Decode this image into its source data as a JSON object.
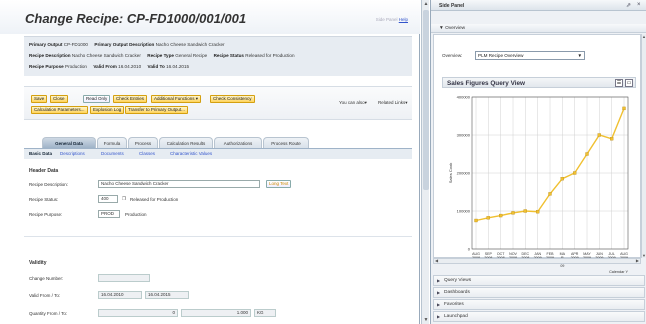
{
  "page": {
    "title": "Change Recipe: CP-FD1000/001/001",
    "side_panel_link_prefix": "Side Panel",
    "side_panel_link": "Help"
  },
  "info": {
    "primary_output_label": "Primary Output",
    "primary_output": "CP-FD1000",
    "primary_output_desc_label": "Primary Output Description",
    "primary_output_desc": "Nacho Cheese Sandwich Cracker",
    "recipe_desc_label": "Recipe Description",
    "recipe_desc": "Nacho Cheese Sandwich Cracker",
    "recipe_type_label": "Recipe Type",
    "recipe_type": "General Recipe",
    "recipe_status_label": "Recipe Status",
    "recipe_status": "Released for Production",
    "recipe_purpose_label": "Recipe Purpose",
    "recipe_purpose": "Production",
    "valid_from_label": "Valid From",
    "valid_from": "16.04.2010",
    "valid_to_label": "Valid To",
    "valid_to": "16.04.2015"
  },
  "toolbar": {
    "save": "Save",
    "close": "Close",
    "read_only": "Read Only",
    "check_entries": "Check Entries",
    "additional_functions": "Additional Functions",
    "check_consistency": "Check Consistency",
    "calc_params": "Calculation Parameters...",
    "explosion_log": "Explosion Log",
    "transfer": "Transfer to Primary Output...",
    "you_can_also": "You can also",
    "related_links": "Related Links"
  },
  "tabs": [
    "General Data",
    "Formula",
    "Process",
    "Calculation Results",
    "Authorizations",
    "Process Route"
  ],
  "subtabs": [
    "Basic Data",
    "Descriptions",
    "Documents",
    "Classes",
    "Characteristic Values"
  ],
  "header_data": {
    "section": "Header Data",
    "recipe_desc_label": "Recipe Description:",
    "recipe_desc_value": "Nacho Cheese Sandwich Cracker",
    "long_text": "Long Text",
    "status_label": "Recipe Status:",
    "status_code": "400",
    "status_text": "Released for Production",
    "purpose_label": "Recipe Purpose:",
    "purpose_code": "PROD",
    "purpose_text": "Production"
  },
  "validity": {
    "section": "Validity",
    "change_number_label": "Change Number:",
    "valid_label": "Valid From / To:",
    "valid_from": "16.04.2010",
    "valid_to": "16.04.2015",
    "qty_label": "Quantity From / To:",
    "qty_from": "0",
    "qty_to": "1.000",
    "qty_unit": "KG"
  },
  "side_panel": {
    "title": "Side Panel",
    "overview": "Overview",
    "overview_label": "Overview:",
    "overview_selected": "PLM Recipe Overview",
    "chart_title": "Sales Figures Query View",
    "accordions": [
      "Query Views",
      "Dashboards",
      "Favorites",
      "Launchpad"
    ]
  },
  "chart_data": {
    "type": "line",
    "ylabel": "Sales Cook",
    "xlabel": "Calendar Y",
    "ylim": [
      0,
      400000
    ],
    "yticks": [
      "400000",
      "300000",
      "200000",
      "100000",
      "0"
    ],
    "categories": [
      "AUG 2008",
      "SEP 2008",
      "OCT 2008",
      "NOV 2008",
      "DEC 2008",
      "JAN 2009",
      "FEB 2009",
      "MA R 20 09",
      "APR 2009",
      "MAY 2009",
      "JUN 2009",
      "JUL 2009",
      "AUG 2009"
    ],
    "values": [
      75000,
      82000,
      88000,
      95000,
      100000,
      98000,
      145000,
      185000,
      200000,
      250000,
      300000,
      290000,
      370000
    ],
    "color": "#f0c030"
  }
}
